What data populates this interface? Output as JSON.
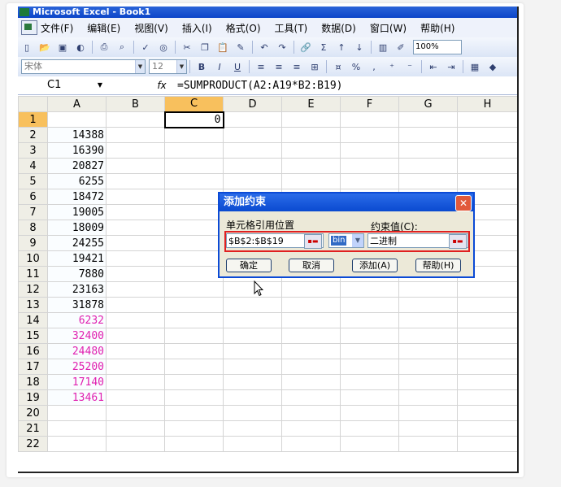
{
  "window": {
    "title": "Microsoft Excel - Book1"
  },
  "menu": [
    "文件(F)",
    "编辑(E)",
    "视图(V)",
    "插入(I)",
    "格式(O)",
    "工具(T)",
    "数据(D)",
    "窗口(W)",
    "帮助(H)"
  ],
  "toolbar": {
    "zoom": "100%",
    "font_name": "宋体",
    "font_size": "12",
    "bold": "B",
    "italic": "I",
    "underline": "U",
    "percent": "%",
    "sum": "Σ"
  },
  "formula_bar": {
    "name_box": "C1",
    "fx": "fx",
    "formula": "=SUMPRODUCT(A2:A19*B2:B19)"
  },
  "columns": [
    "A",
    "B",
    "C",
    "D",
    "E",
    "F",
    "G",
    "H"
  ],
  "rows": [
    {
      "row": "1",
      "a": "",
      "c": "0"
    },
    {
      "row": "2",
      "a": "14388"
    },
    {
      "row": "3",
      "a": "16390"
    },
    {
      "row": "4",
      "a": "20827"
    },
    {
      "row": "5",
      "a": "6255"
    },
    {
      "row": "6",
      "a": "18472"
    },
    {
      "row": "7",
      "a": "19005"
    },
    {
      "row": "8",
      "a": "18009"
    },
    {
      "row": "9",
      "a": "24255"
    },
    {
      "row": "10",
      "a": "19421"
    },
    {
      "row": "11",
      "a": "7880"
    },
    {
      "row": "12",
      "a": "23163"
    },
    {
      "row": "13",
      "a": "31878"
    },
    {
      "row": "14",
      "a": "6232",
      "pink": true
    },
    {
      "row": "15",
      "a": "32400",
      "pink": true
    },
    {
      "row": "16",
      "a": "24480",
      "pink": true
    },
    {
      "row": "17",
      "a": "25200",
      "pink": true
    },
    {
      "row": "18",
      "a": "17140",
      "pink": true
    },
    {
      "row": "19",
      "a": "13461",
      "pink": true
    },
    {
      "row": "20",
      "a": ""
    },
    {
      "row": "21",
      "a": ""
    },
    {
      "row": "22",
      "a": ""
    }
  ],
  "dialog": {
    "title": "添加约束",
    "close": "✕",
    "cell_ref_label": "单元格引用位置",
    "cell_ref_value": "$B$2:$B$19",
    "operator": "bin",
    "constraint_label": "约束值(C):",
    "constraint_value": "二进制",
    "ok": "确定",
    "cancel": "取消",
    "add": "添加(A)",
    "help": "帮助(H)"
  },
  "colors": {
    "title_blue": "#0b4ad6",
    "highlight_pink": "#e020b0",
    "selected_header": "#f8c05d",
    "red_outline": "#e02020"
  }
}
